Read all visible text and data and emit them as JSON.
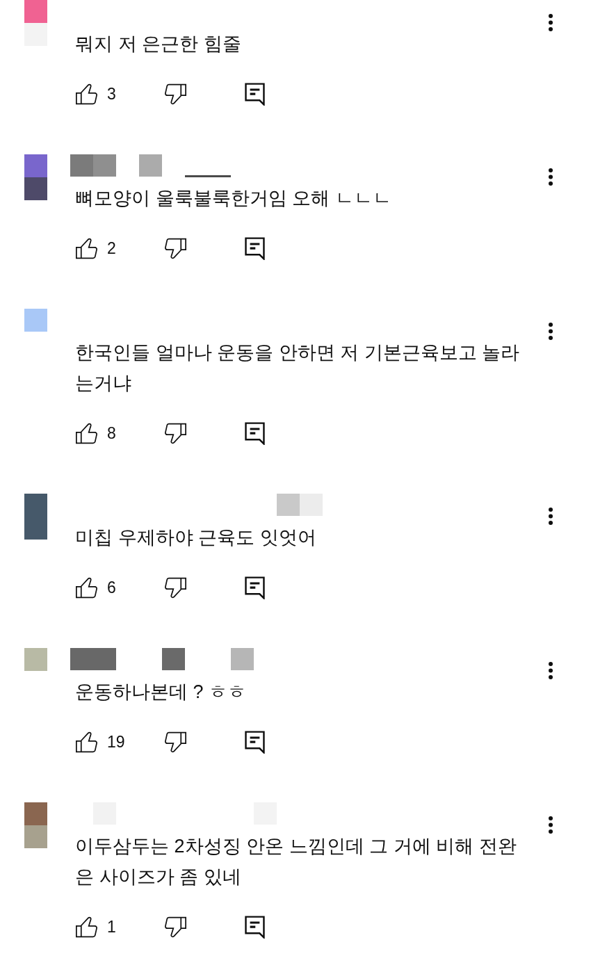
{
  "comments": [
    {
      "avatar": [
        {
          "color": "#f06292"
        },
        {
          "color": "#f3f3f3"
        }
      ],
      "lines": [
        "뭐지 저 은근한 힘줄"
      ],
      "likes": "3"
    },
    {
      "avatar": [
        {
          "color": "#7966cc"
        },
        {
          "color": "#4e4a69"
        }
      ],
      "username_mosaic": [
        {
          "kind": "tile",
          "color": "#7b7b7b"
        },
        {
          "kind": "tile",
          "color": "#8f8f8f"
        },
        {
          "kind": "gap"
        },
        {
          "kind": "tile",
          "color": "#ababab"
        },
        {
          "kind": "gap"
        },
        {
          "kind": "underline",
          "color": "#4a4a4a"
        }
      ],
      "lines": [
        "뼈모양이 울룩불룩한거임 오해 ㄴㄴㄴ"
      ],
      "likes": "2"
    },
    {
      "avatar": [
        {
          "color": "#a9c8f7"
        }
      ],
      "lines": [
        "한국인들 얼마나 운동을 안하면 저 기본근육보고 놀라",
        "는거냐"
      ],
      "likes": "8"
    },
    {
      "avatar": [
        {
          "color": "#46596a"
        },
        {
          "color": "#46596a"
        }
      ],
      "username_mosaic": [
        {
          "kind": "gap"
        },
        {
          "kind": "gap"
        },
        {
          "kind": "gap"
        },
        {
          "kind": "gap"
        },
        {
          "kind": "gap"
        },
        {
          "kind": "gap"
        },
        {
          "kind": "gap"
        },
        {
          "kind": "gap"
        },
        {
          "kind": "gap"
        },
        {
          "kind": "tile",
          "color": "#c9c9c9"
        },
        {
          "kind": "tile",
          "color": "#ececec"
        }
      ],
      "lines": [
        "미칩 우제하야 근육도 잇엇어"
      ],
      "likes": "6"
    },
    {
      "avatar": [
        {
          "color": "#b8baa5"
        }
      ],
      "username_mosaic": [
        {
          "kind": "tile",
          "color": "#686868"
        },
        {
          "kind": "tile",
          "color": "#686868"
        },
        {
          "kind": "gap"
        },
        {
          "kind": "gap"
        },
        {
          "kind": "tile",
          "color": "#6a6a6a"
        },
        {
          "kind": "gap"
        },
        {
          "kind": "gap"
        },
        {
          "kind": "tile",
          "color": "#b6b6b6"
        }
      ],
      "lines": [
        "운동하나본데 ? ㅎㅎ"
      ],
      "likes": "19"
    },
    {
      "avatar": [
        {
          "color": "#8a6650"
        },
        {
          "color": "#a7a18e"
        }
      ],
      "username_mosaic": [
        {
          "kind": "gap"
        },
        {
          "kind": "tile",
          "color": "#f2f2f2"
        },
        {
          "kind": "gap"
        },
        {
          "kind": "gap"
        },
        {
          "kind": "gap"
        },
        {
          "kind": "gap"
        },
        {
          "kind": "gap"
        },
        {
          "kind": "gap"
        },
        {
          "kind": "tile",
          "color": "#f3f3f3"
        }
      ],
      "lines": [
        "이두삼두는 2차성징 안온 느낌인데 그 거에 비해 전완",
        "은 사이즈가 좀 있네"
      ],
      "likes": "1"
    }
  ]
}
